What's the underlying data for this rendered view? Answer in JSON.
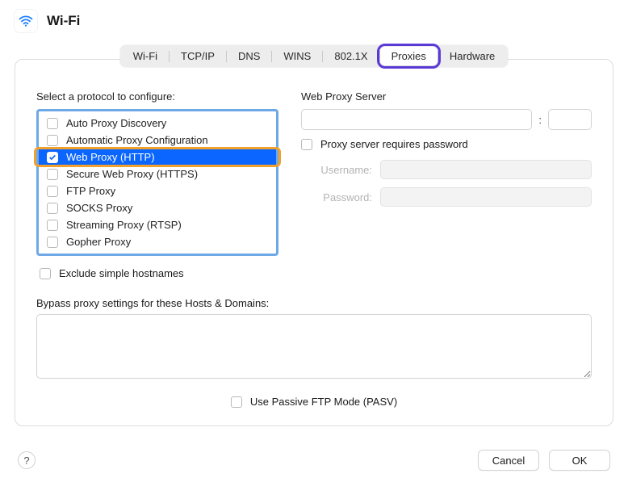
{
  "header": {
    "title": "Wi-Fi"
  },
  "tabs": {
    "items": [
      "Wi-Fi",
      "TCP/IP",
      "DNS",
      "WINS",
      "802.1X",
      "Proxies",
      "Hardware"
    ],
    "active_index": 5
  },
  "left": {
    "label": "Select a protocol to configure:",
    "protocols": [
      {
        "label": "Auto Proxy Discovery",
        "checked": false,
        "selected": false
      },
      {
        "label": "Automatic Proxy Configuration",
        "checked": false,
        "selected": false
      },
      {
        "label": "Web Proxy (HTTP)",
        "checked": true,
        "selected": true
      },
      {
        "label": "Secure Web Proxy (HTTPS)",
        "checked": false,
        "selected": false
      },
      {
        "label": "FTP Proxy",
        "checked": false,
        "selected": false
      },
      {
        "label": "SOCKS Proxy",
        "checked": false,
        "selected": false
      },
      {
        "label": "Streaming Proxy (RTSP)",
        "checked": false,
        "selected": false
      },
      {
        "label": "Gopher Proxy",
        "checked": false,
        "selected": false
      }
    ],
    "exclude_label": "Exclude simple hostnames",
    "exclude_checked": false
  },
  "right": {
    "server_label": "Web Proxy Server",
    "server_host": "",
    "server_port": "",
    "requires_password_label": "Proxy server requires password",
    "requires_password_checked": false,
    "username_label": "Username:",
    "username_value": "",
    "password_label": "Password:",
    "password_value": ""
  },
  "bypass": {
    "label": "Bypass proxy settings for these Hosts & Domains:",
    "value": ""
  },
  "pasv": {
    "label": "Use Passive FTP Mode (PASV)",
    "checked": false
  },
  "footer": {
    "help": "?",
    "cancel": "Cancel",
    "ok": "OK"
  }
}
